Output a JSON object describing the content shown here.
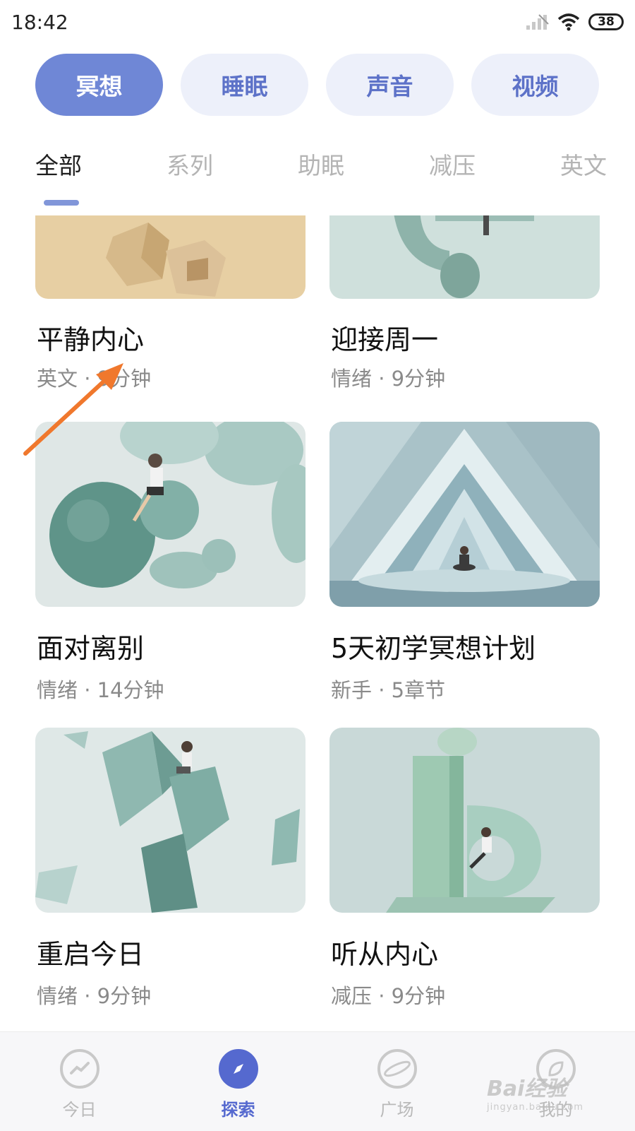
{
  "status_bar": {
    "time": "18:42",
    "battery": "38"
  },
  "seg_tabs": [
    {
      "label": "冥想",
      "active": true
    },
    {
      "label": "睡眠",
      "active": false
    },
    {
      "label": "声音",
      "active": false
    },
    {
      "label": "视频",
      "active": false
    }
  ],
  "sub_tabs": [
    {
      "label": "全部",
      "active": true
    },
    {
      "label": "系列",
      "active": false
    },
    {
      "label": "助眠",
      "active": false
    },
    {
      "label": "减压",
      "active": false
    },
    {
      "label": "英文",
      "active": false
    }
  ],
  "cards": [
    {
      "title": "平静内心",
      "meta": "英文 · 9分钟",
      "theme": "warm-cubes"
    },
    {
      "title": "迎接周一",
      "meta": "情绪 · 9分钟",
      "theme": "teal-rings"
    },
    {
      "title": "面对离别",
      "meta": "情绪 · 14分钟",
      "theme": "teal-spheres"
    },
    {
      "title": "5天初学冥想计划",
      "meta": "新手 · 5章节",
      "theme": "teal-triangles"
    },
    {
      "title": "重启今日",
      "meta": "情绪 · 9分钟",
      "theme": "teal-crystals"
    },
    {
      "title": "听从内心",
      "meta": "减压 · 9分钟",
      "theme": "teal-letters"
    }
  ],
  "bottom_nav": [
    {
      "label": "今日",
      "icon": "trend-icon",
      "active": false
    },
    {
      "label": "探索",
      "icon": "compass-icon",
      "active": true
    },
    {
      "label": "广场",
      "icon": "planet-icon",
      "active": false
    },
    {
      "label": "我的",
      "icon": "leaf-icon",
      "active": false
    }
  ],
  "watermark": {
    "main": "Bai经验",
    "sub": "jingyan.baidu.com"
  },
  "colors": {
    "accent": "#6f87d6",
    "accent_dark": "#5569cf",
    "chip_bg": "#edf0fa",
    "annotation": "#f0782d"
  }
}
